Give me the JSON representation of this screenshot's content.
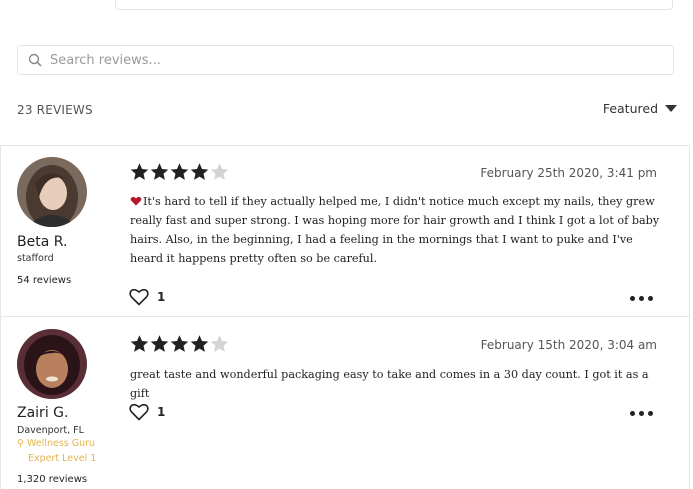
{
  "search": {
    "placeholder": "Search reviews..."
  },
  "summary": {
    "count_label": "23 REVIEWS",
    "sort_label": "Featured"
  },
  "reviews": [
    {
      "name": "Beta R.",
      "location": "stafford",
      "review_count": "54 reviews",
      "rating": 4,
      "date": "February 25th 2020, 3:41 pm",
      "text": "It's hard to tell if they actually helped me, I didn't notice much except my nails, they grew really fast and super strong. I was hoping more for hair growth and I think I got a lot of baby hairs. Also, in the beginning, I had a feeling in the mornings that I want to puke and I've heard it happens pretty often so be careful.",
      "likes": "1"
    },
    {
      "name": "Zairi G.",
      "location": "Davenport, FL",
      "badge_line1": "Wellness Guru",
      "badge_line2": "Expert Level 1",
      "review_count": "1,320 reviews",
      "rating": 4,
      "date": "February 15th 2020, 3:04 am",
      "text": "great taste and wonderful packaging easy to take and comes in a 30 day count. I got it as a gift",
      "likes": "1"
    }
  ],
  "colors": {
    "badge": "#e5b44d",
    "star_filled": "#222222",
    "star_empty": "#d3d3d3"
  }
}
